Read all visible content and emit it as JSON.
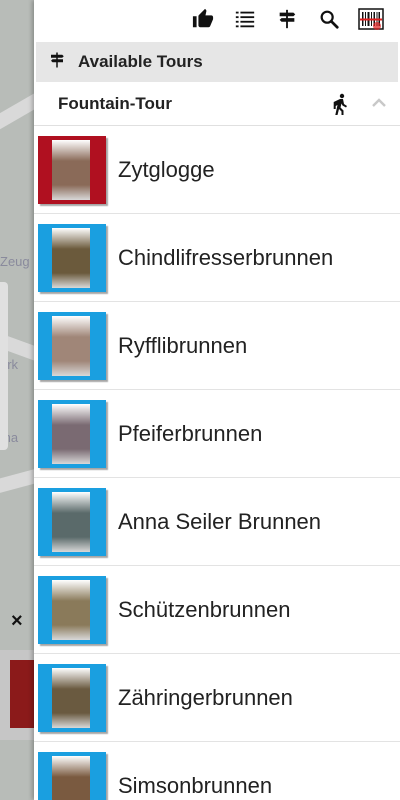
{
  "toolbar": {
    "icons": [
      "thumbs-up-icon",
      "list-icon",
      "signpost-icon",
      "search-icon",
      "barcode-scanner-icon"
    ]
  },
  "section": {
    "title": "Available Tours",
    "icon": "signpost-icon"
  },
  "tour": {
    "name": "Fountain-Tour",
    "mode_icon": "walking-person-icon",
    "toggle_icon": "chevron-up-icon"
  },
  "items": [
    {
      "label": "Zytglogge",
      "frame_color": "#b01020",
      "photo_color": "#8a6a58"
    },
    {
      "label": "Chindlifresserbrunnen",
      "frame_color": "#1a9fe0",
      "photo_color": "#6b5a3c"
    },
    {
      "label": "Ryfflibrunnen",
      "frame_color": "#1a9fe0",
      "photo_color": "#a08678"
    },
    {
      "label": "Pfeiferbrunnen",
      "frame_color": "#1a9fe0",
      "photo_color": "#7a6a72"
    },
    {
      "label": "Anna Seiler Brunnen",
      "frame_color": "#1a9fe0",
      "photo_color": "#5a6a6a"
    },
    {
      "label": "Schützenbrunnen",
      "frame_color": "#1a9fe0",
      "photo_color": "#8a7a5a"
    },
    {
      "label": "Zähringerbrunnen",
      "frame_color": "#1a9fe0",
      "photo_color": "#6a5a40"
    },
    {
      "label": "Simsonbrunnen",
      "frame_color": "#1a9fe0",
      "photo_color": "#7a5a40"
    }
  ],
  "map": {
    "labels": [
      "Zeug",
      "ark",
      "tha"
    ],
    "close_glyph": "×"
  }
}
